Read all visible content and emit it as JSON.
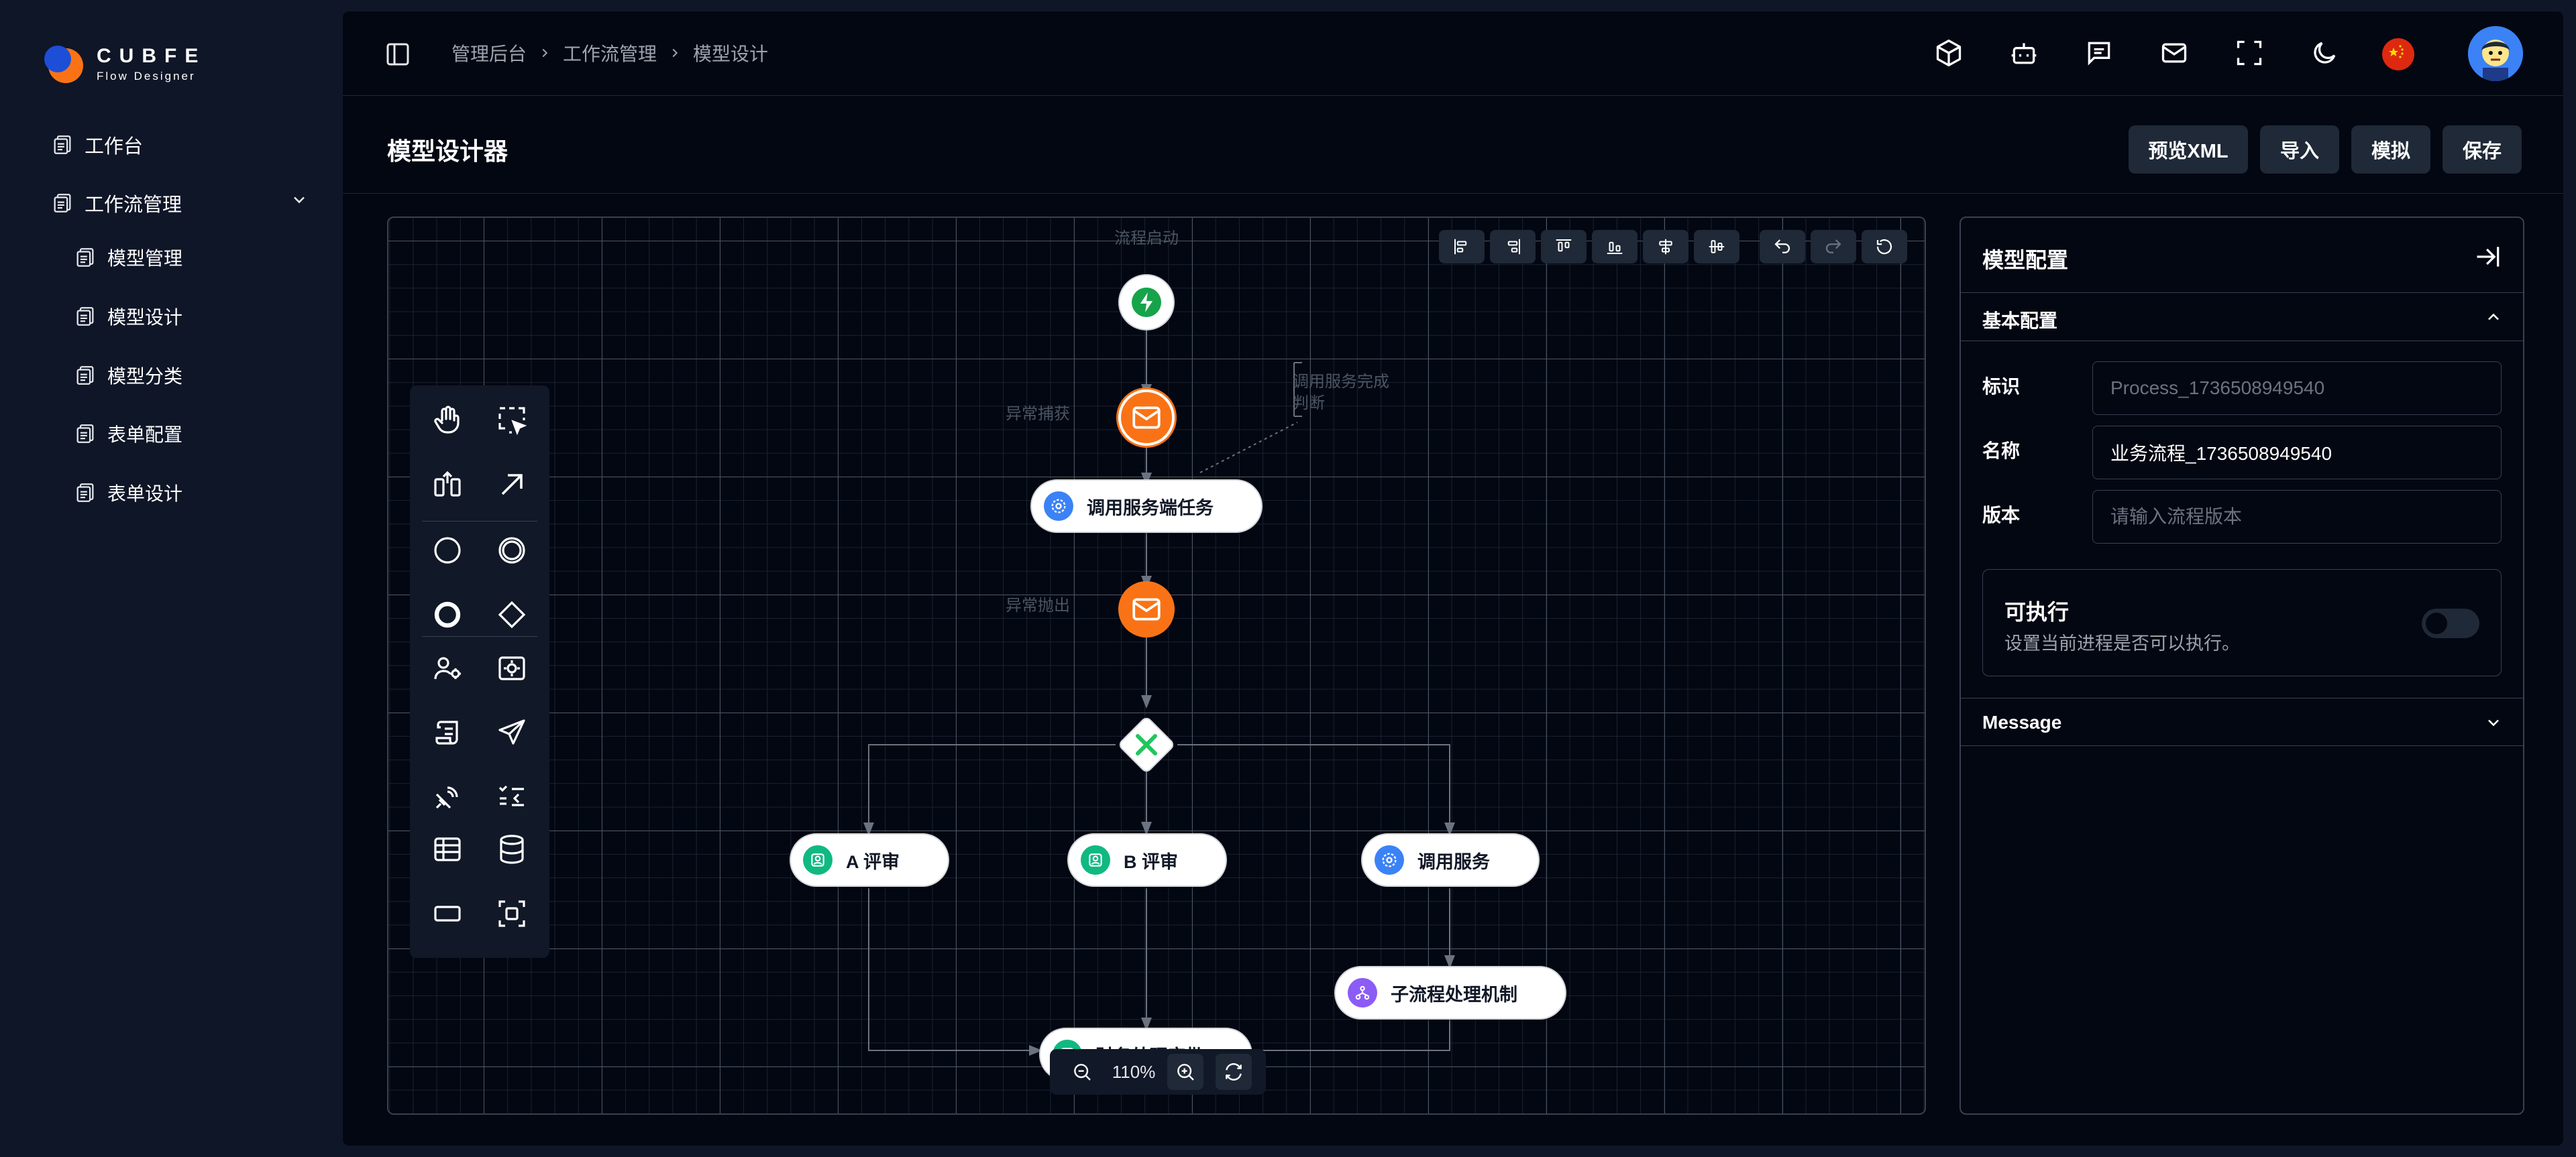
{
  "app": {
    "logo_title": "CUBFE",
    "logo_subtitle": "Flow Designer"
  },
  "sidebar": {
    "items": [
      {
        "label": "工作台"
      },
      {
        "label": "工作流管理"
      },
      {
        "label": "模型管理"
      },
      {
        "label": "模型设计"
      },
      {
        "label": "模型分类"
      },
      {
        "label": "表单配置"
      },
      {
        "label": "表单设计"
      }
    ]
  },
  "breadcrumb": [
    "管理后台",
    "工作流管理",
    "模型设计"
  ],
  "header_icons": [
    "cube-icon",
    "bot-icon",
    "chat-icon",
    "mail-icon",
    "fullscreen-icon",
    "moon-icon",
    "china-flag-icon",
    "user-avatar"
  ],
  "page": {
    "title": "模型设计器",
    "buttons": {
      "preview": "预览XML",
      "import": "导入",
      "simulate": "模拟",
      "save": "保存"
    }
  },
  "canvas": {
    "nodes": {
      "service_task": "调用服务端任务",
      "a_review": "A 评审",
      "b_review": "B 评审",
      "call_service": "调用服务",
      "subprocess": "子流程处理机制",
      "finance": "财务处理审批"
    },
    "faint_labels": {
      "start": "流程启动",
      "catch": "异常捕获",
      "throw": "异常抛出",
      "comment_1": "调用服务完成",
      "comment_2": "判断"
    },
    "zoom": "110%"
  },
  "panel": {
    "title": "模型配置",
    "basic_section": "基本配置",
    "fields": {
      "id_label": "标识",
      "id_value": "Process_1736508949540",
      "name_label": "名称",
      "name_value": "业务流程_1736508949540",
      "version_label": "版本",
      "version_placeholder": "请输入流程版本"
    },
    "executable": {
      "title": "可执行",
      "desc": "设置当前进程是否可以执行。",
      "enabled": false
    },
    "message_section": "Message"
  },
  "colors": {
    "accent_orange": "#f97316",
    "start_green": "#16a34a",
    "gateway_green": "#22c55e",
    "service_blue": "#3b82f6",
    "user_green": "#10b981",
    "subprocess_purple": "#8b5cf6"
  }
}
